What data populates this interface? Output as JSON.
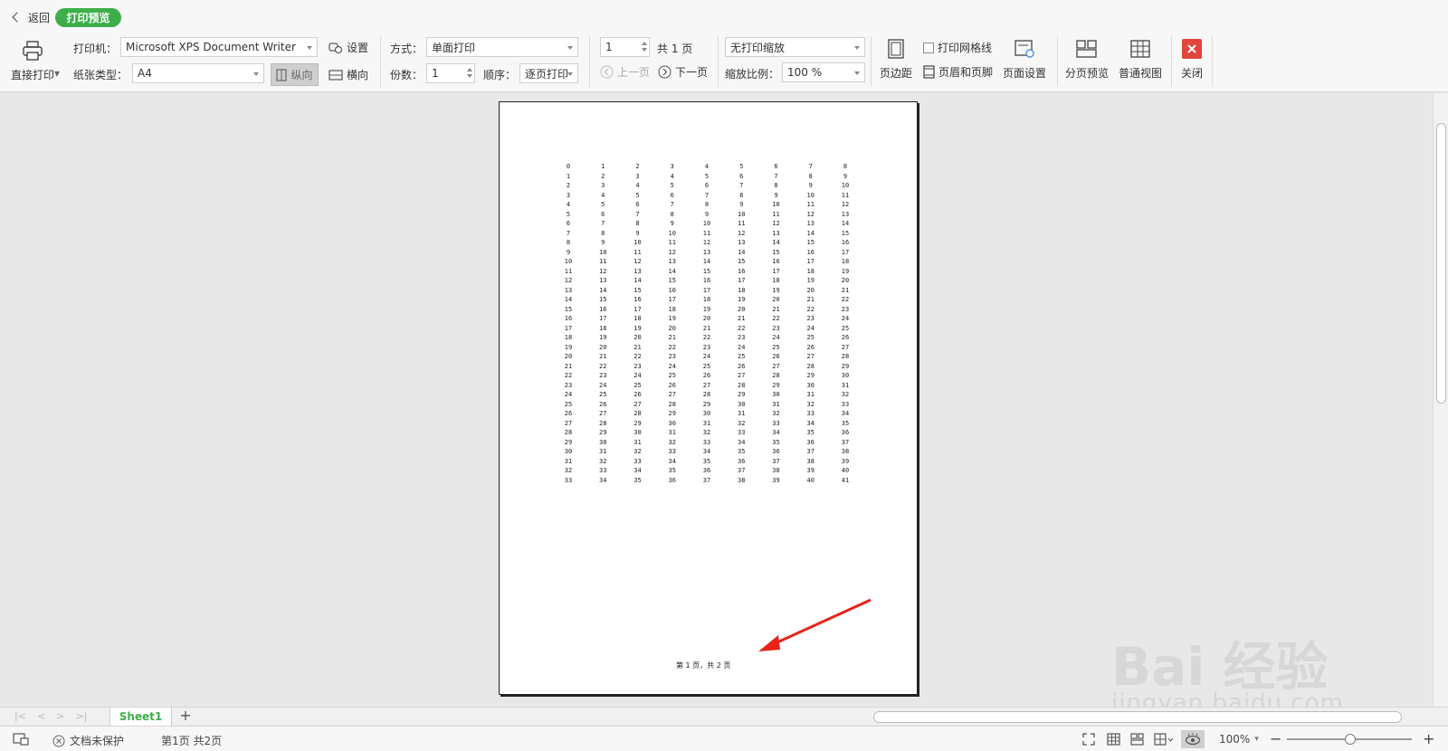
{
  "header": {
    "back_label": "返回",
    "mode_label": "打印预览"
  },
  "toolbar": {
    "direct_print": "直接打印",
    "printer_label": "打印机：",
    "printer_value": "Microsoft XPS Document Writer",
    "settings_label": "设置",
    "paper_label": "纸张类型：",
    "paper_value": "A4",
    "portrait_label": "纵向",
    "landscape_label": "横向",
    "mode_field_label": "方式：",
    "mode_value": "单面打印",
    "copies_label": "份数：",
    "copies_value": "1",
    "order_label": "顺序：",
    "order_value": "逐页打印",
    "page_value": "1",
    "page_total": "共 1 页",
    "prev_page": "上一页",
    "next_page": "下一页",
    "scale_value": "无打印缩放",
    "scale_ratio_label": "缩放比例：",
    "scale_ratio_value": "100 %",
    "margins": "页边距",
    "gridlines": "打印网格线",
    "header_footer": "页眉和页脚",
    "page_setup": "页面设置",
    "page_break_preview": "分页预览",
    "normal_view": "普通视图",
    "close": "关闭"
  },
  "page": {
    "columns": [
      [
        "0",
        "1",
        "2",
        "3",
        "4",
        "5",
        "6",
        "7",
        "8",
        "9",
        "10",
        "11",
        "12",
        "13",
        "14",
        "15",
        "16",
        "17",
        "18",
        "19",
        "20",
        "21",
        "22",
        "23",
        "24",
        "25",
        "26",
        "27",
        "28",
        "29",
        "30",
        "31",
        "32",
        "33"
      ],
      [
        "1",
        "2",
        "3",
        "4",
        "5",
        "6",
        "7",
        "8",
        "9",
        "10",
        "11",
        "12",
        "13",
        "14",
        "15",
        "16",
        "17",
        "18",
        "19",
        "20",
        "21",
        "22",
        "23",
        "24",
        "25",
        "26",
        "27",
        "28",
        "29",
        "30",
        "31",
        "32",
        "33",
        "34"
      ],
      [
        "2",
        "3",
        "4",
        "5",
        "6",
        "7",
        "8",
        "9",
        "10",
        "11",
        "12",
        "13",
        "14",
        "15",
        "16",
        "17",
        "18",
        "19",
        "20",
        "21",
        "22",
        "23",
        "24",
        "25",
        "26",
        "27",
        "28",
        "29",
        "30",
        "31",
        "32",
        "33",
        "34",
        "35"
      ],
      [
        "3",
        "4",
        "5",
        "6",
        "7",
        "8",
        "9",
        "10",
        "11",
        "12",
        "13",
        "14",
        "15",
        "16",
        "17",
        "18",
        "19",
        "20",
        "21",
        "22",
        "23",
        "24",
        "25",
        "26",
        "27",
        "28",
        "29",
        "30",
        "31",
        "32",
        "33",
        "34",
        "35",
        "36"
      ],
      [
        "4",
        "5",
        "6",
        "7",
        "8",
        "9",
        "10",
        "11",
        "12",
        "13",
        "14",
        "15",
        "16",
        "17",
        "18",
        "19",
        "20",
        "21",
        "22",
        "23",
        "24",
        "25",
        "26",
        "27",
        "28",
        "29",
        "30",
        "31",
        "32",
        "33",
        "34",
        "35",
        "36",
        "37"
      ],
      [
        "5",
        "6",
        "7",
        "8",
        "9",
        "10",
        "11",
        "12",
        "13",
        "14",
        "15",
        "16",
        "17",
        "18",
        "19",
        "20",
        "21",
        "22",
        "23",
        "24",
        "25",
        "26",
        "27",
        "28",
        "29",
        "30",
        "31",
        "32",
        "33",
        "34",
        "35",
        "36",
        "37",
        "38"
      ],
      [
        "6",
        "7",
        "8",
        "9",
        "10",
        "11",
        "12",
        "13",
        "14",
        "15",
        "16",
        "17",
        "18",
        "19",
        "20",
        "21",
        "22",
        "23",
        "24",
        "25",
        "26",
        "27",
        "28",
        "29",
        "30",
        "31",
        "32",
        "33",
        "34",
        "35",
        "36",
        "37",
        "38",
        "39"
      ],
      [
        "7",
        "8",
        "9",
        "10",
        "11",
        "12",
        "13",
        "14",
        "15",
        "16",
        "17",
        "18",
        "19",
        "20",
        "21",
        "22",
        "23",
        "24",
        "25",
        "26",
        "27",
        "28",
        "29",
        "30",
        "31",
        "32",
        "33",
        "34",
        "35",
        "36",
        "37",
        "38",
        "39",
        "40"
      ],
      [
        "8",
        "9",
        "10",
        "11",
        "12",
        "13",
        "14",
        "15",
        "16",
        "17",
        "18",
        "19",
        "20",
        "21",
        "22",
        "23",
        "24",
        "25",
        "26",
        "27",
        "28",
        "29",
        "30",
        "31",
        "32",
        "33",
        "34",
        "35",
        "36",
        "37",
        "38",
        "39",
        "40",
        "41"
      ]
    ],
    "footer": "第 1 页，共 2 页"
  },
  "tabs": {
    "sheet1": "Sheet1",
    "add": "+"
  },
  "status": {
    "protection": "文档未保护",
    "page_info": "第1页 共2页",
    "zoom": "100%"
  },
  "watermark": {
    "main": "Bai 经验",
    "sub": "jingyan.baidu.com"
  },
  "colors": {
    "accent_green": "#3dae4a",
    "close_red": "#e0463c",
    "arrow_red": "#e8231a"
  }
}
